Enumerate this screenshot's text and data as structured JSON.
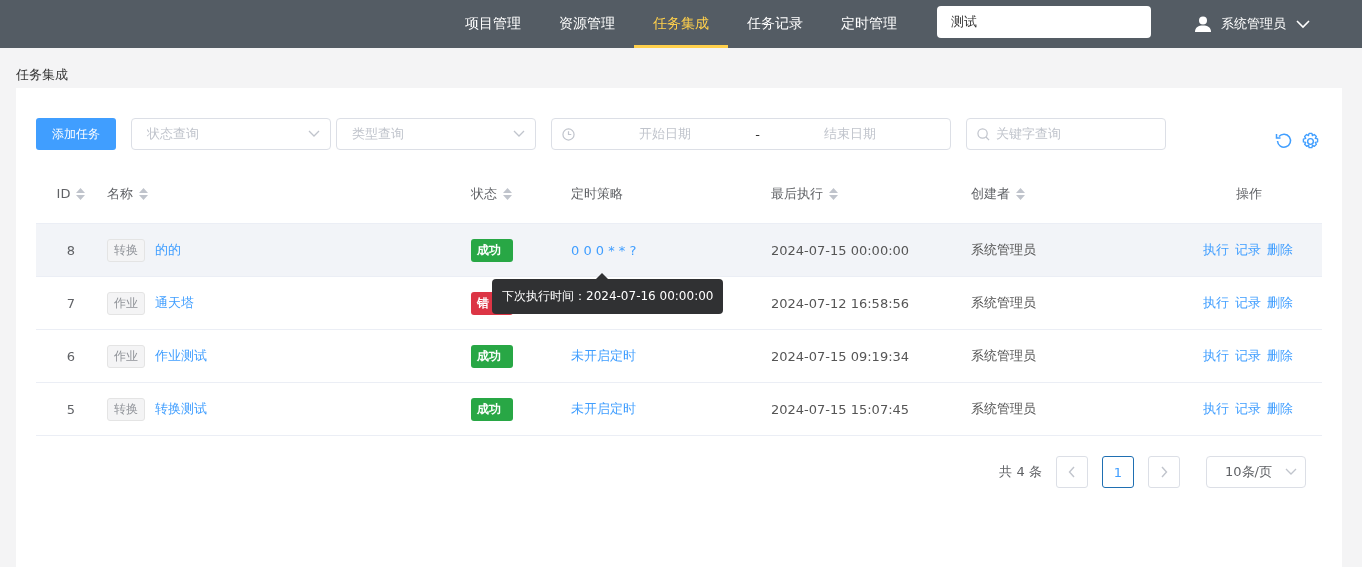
{
  "nav": {
    "items": [
      {
        "label": "项目管理",
        "selected": false
      },
      {
        "label": "资源管理",
        "selected": false
      },
      {
        "label": "任务集成",
        "selected": true
      },
      {
        "label": "任务记录",
        "selected": false
      },
      {
        "label": "定时管理",
        "selected": false
      }
    ],
    "search": {
      "value": "测试"
    },
    "user": "系统管理员"
  },
  "breadcrumb": "任务集成",
  "toolbar": {
    "add_button": "添加任务",
    "status_filter": {
      "placeholder": "状态查询"
    },
    "type_filter": {
      "placeholder": "类型查询"
    },
    "date_range": {
      "start_placeholder": "开始日期",
      "separator": "-",
      "end_placeholder": "结束日期"
    },
    "keyword": {
      "placeholder": "关键字查询"
    }
  },
  "table": {
    "columns": [
      {
        "label": "ID",
        "sortable": true
      },
      {
        "label": "名称",
        "sortable": true
      },
      {
        "label": "状态",
        "sortable": true
      },
      {
        "label": "定时策略",
        "sortable": false
      },
      {
        "label": "最后执行",
        "sortable": true
      },
      {
        "label": "创建者",
        "sortable": true
      },
      {
        "label": "操作",
        "sortable": false
      }
    ],
    "rows": [
      {
        "id": "8",
        "type": "转换",
        "name": "的的",
        "status": {
          "text": "成功",
          "color": "#28a745"
        },
        "schedule": "0 0 0 * * ?",
        "tooltip": "下次执行时间：2024-07-16 00:00:00",
        "last_run": "2024-07-15 00:00:00",
        "creator": "系统管理员",
        "actions": [
          "执行",
          "记录",
          "删除"
        ],
        "hovered": true
      },
      {
        "id": "7",
        "type": "作业",
        "name": "通天塔",
        "status": {
          "text": "错",
          "color": "#dc3545"
        },
        "last_run": "2024-07-12 16:58:56",
        "creator": "系统管理员",
        "actions": [
          "执行",
          "记录",
          "删除"
        ],
        "hovered": false
      },
      {
        "id": "6",
        "type": "作业",
        "name": "作业测试",
        "status": {
          "text": "成功",
          "color": "#28a745"
        },
        "schedule": "未开启定时",
        "last_run": "2024-07-15 09:19:34",
        "creator": "系统管理员",
        "actions": [
          "执行",
          "记录",
          "删除"
        ],
        "hovered": false
      },
      {
        "id": "5",
        "type": "转换",
        "name": "转换测试",
        "status": {
          "text": "成功",
          "color": "#28a745"
        },
        "schedule": "未开启定时",
        "last_run": "2024-07-15 15:07:45",
        "creator": "系统管理员",
        "actions": [
          "执行",
          "记录",
          "删除"
        ],
        "hovered": false
      }
    ]
  },
  "pagination": {
    "total": "共 4 条",
    "pages": [
      {
        "label": "1",
        "selected": true
      }
    ],
    "page_size": "10条/页"
  }
}
